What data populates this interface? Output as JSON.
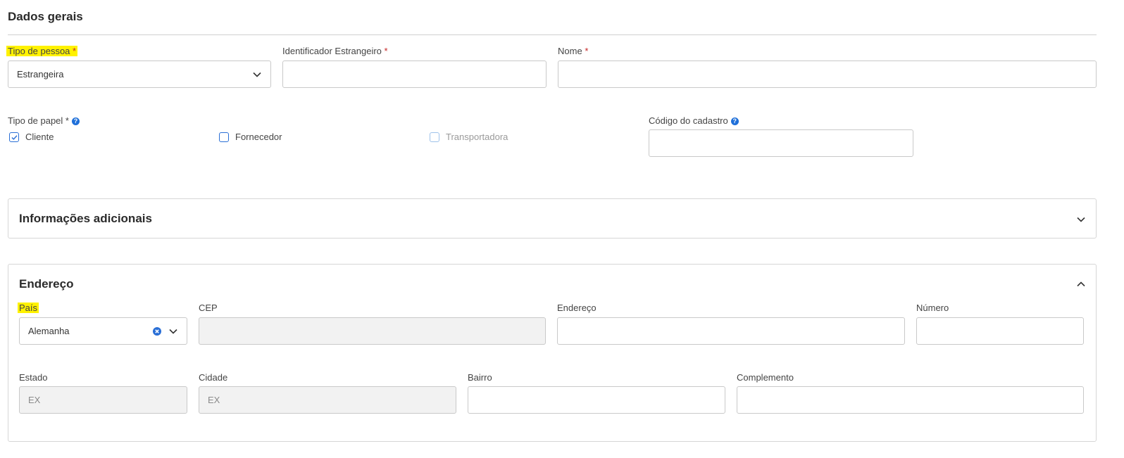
{
  "general": {
    "title": "Dados gerais",
    "tipo_pessoa": {
      "label": "Tipo de pessoa",
      "required": "*",
      "value": "Estrangeira"
    },
    "identificador": {
      "label": "Identificador Estrangeiro",
      "required": "*",
      "value": ""
    },
    "nome": {
      "label": "Nome",
      "required": "*",
      "value": ""
    },
    "tipo_papel": {
      "label": "Tipo de papel *",
      "options": [
        {
          "label": "Cliente",
          "checked": true,
          "disabled": false
        },
        {
          "label": "Fornecedor",
          "checked": false,
          "disabled": false
        },
        {
          "label": "Transportadora",
          "checked": false,
          "disabled": true
        }
      ]
    },
    "codigo": {
      "label": "Código do cadastro",
      "value": ""
    }
  },
  "info_adicionais": {
    "title": "Informações adicionais",
    "expanded": false
  },
  "endereco": {
    "title": "Endereço",
    "expanded": true,
    "pais": {
      "label": "País",
      "value": "Alemanha"
    },
    "cep": {
      "label": "CEP",
      "value": ""
    },
    "endereco": {
      "label": "Endereço",
      "value": ""
    },
    "numero": {
      "label": "Número",
      "value": ""
    },
    "estado": {
      "label": "Estado",
      "value": "EX"
    },
    "cidade": {
      "label": "Cidade",
      "value": "EX"
    },
    "bairro": {
      "label": "Bairro",
      "value": ""
    },
    "complemento": {
      "label": "Complemento",
      "value": ""
    }
  },
  "icons": {
    "help": "question-circle-icon",
    "chevron_down": "chevron-down-icon",
    "chevron_up": "chevron-up-icon",
    "clear": "clear-icon",
    "check": "check-icon"
  },
  "colors": {
    "accent": "#2a6fd6",
    "required": "#c62828",
    "highlight": "#fff200"
  }
}
